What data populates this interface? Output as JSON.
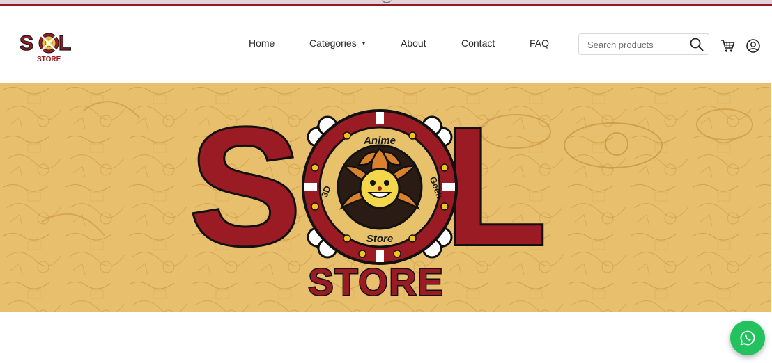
{
  "nav": {
    "items": [
      {
        "label": "Home"
      },
      {
        "label": "Categories"
      },
      {
        "label": "About"
      },
      {
        "label": "Contact"
      },
      {
        "label": "FAQ"
      }
    ],
    "categories_caret": "▾"
  },
  "search": {
    "placeholder": "Search products"
  },
  "icons": {
    "search": "search-icon",
    "cart": "cart-icon",
    "account": "user-icon",
    "whatsapp": "whatsapp-icon",
    "browser_extension": "extension-icon"
  },
  "colors": {
    "brand_red": "#9b1b24",
    "banner_bg": "#e8bf6c",
    "accent_gold": "#e8c24a",
    "whatsapp_green": "#22c35e"
  },
  "logo": {
    "emblem_top": "Anime",
    "emblem_bottom": "Store",
    "emblem_left": "3D",
    "emblem_right": "Geek"
  }
}
